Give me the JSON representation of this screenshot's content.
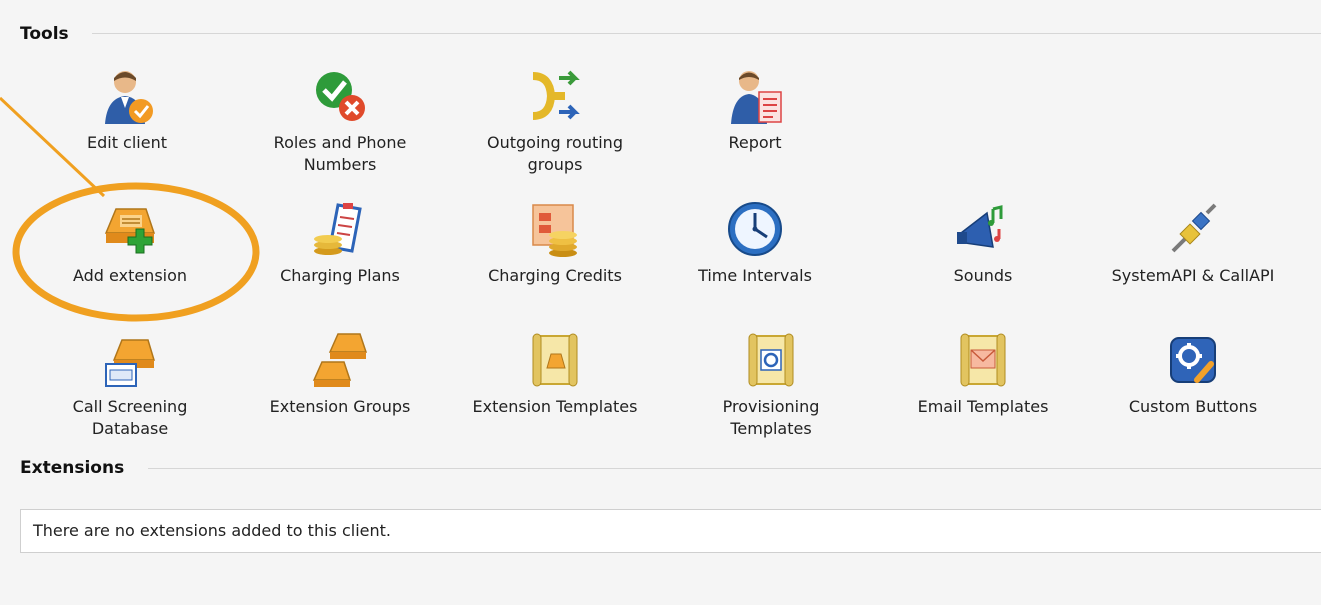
{
  "tools_section": {
    "title": "Tools"
  },
  "tools": [
    {
      "id": "edit-client",
      "label": "Edit client",
      "icon": "user-check-icon"
    },
    {
      "id": "roles-and-phone-numbers",
      "label": "Roles and Phone Numbers",
      "icon": "check-cross-icon"
    },
    {
      "id": "outgoing-routing-groups",
      "label": "Outgoing routing groups",
      "icon": "routing-arrows-icon"
    },
    {
      "id": "report",
      "label": "Report",
      "icon": "user-report-icon"
    },
    {
      "id": "add-extension",
      "label": "Add extension",
      "icon": "phone-plus-icon"
    },
    {
      "id": "charging-plans",
      "label": "Charging Plans",
      "icon": "coins-clipboard-icon"
    },
    {
      "id": "charging-credits",
      "label": "Charging Credits",
      "icon": "coins-card-icon"
    },
    {
      "id": "time-intervals",
      "label": "Time Intervals",
      "icon": "clock-icon"
    },
    {
      "id": "sounds",
      "label": "Sounds",
      "icon": "megaphone-icon"
    },
    {
      "id": "systemapi-callapi",
      "label": "SystemAPI & CallAPI",
      "icon": "plug-icon"
    },
    {
      "id": "call-screening-database",
      "label": "Call Screening Database",
      "icon": "phone-database-icon"
    },
    {
      "id": "extension-groups",
      "label": "Extension Groups",
      "icon": "phone-group-icon"
    },
    {
      "id": "extension-templates",
      "label": "Extension Templates",
      "icon": "scroll-phone-icon"
    },
    {
      "id": "provisioning-templates",
      "label": "Provisioning Templates",
      "icon": "scroll-gear-icon"
    },
    {
      "id": "email-templates",
      "label": "Email Templates",
      "icon": "scroll-envelope-icon"
    },
    {
      "id": "custom-buttons",
      "label": "Custom Buttons",
      "icon": "gear-wrench-icon"
    }
  ],
  "extensions_section": {
    "title": "Extensions",
    "empty_message": "There are no extensions added to this client."
  },
  "colors": {
    "highlight": "#f0a020",
    "background": "#f5f5f5",
    "divider": "#d6d6d6"
  }
}
